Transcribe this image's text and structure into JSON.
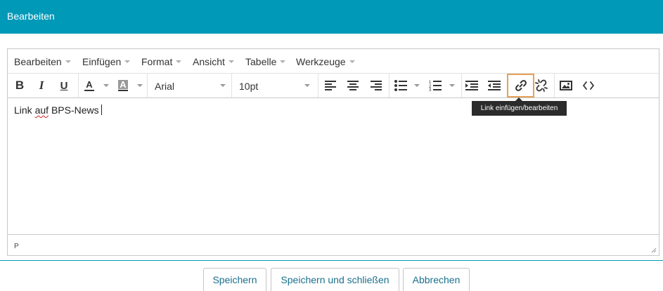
{
  "header": {
    "title": "Bearbeiten"
  },
  "menubar": {
    "items": [
      {
        "label": "Bearbeiten"
      },
      {
        "label": "Einfügen"
      },
      {
        "label": "Format"
      },
      {
        "label": "Ansicht"
      },
      {
        "label": "Tabelle"
      },
      {
        "label": "Werkzeuge"
      }
    ]
  },
  "toolbar": {
    "font_family": "Arial",
    "font_size": "10pt",
    "icons": [
      "bold-icon",
      "italic-icon",
      "underline-icon",
      "text-color-icon",
      "background-color-icon",
      "align-left-icon",
      "align-center-icon",
      "align-right-icon",
      "bullet-list-icon",
      "numbered-list-icon",
      "indent-icon",
      "outdent-icon",
      "link-icon",
      "unlink-icon",
      "image-icon",
      "source-code-icon"
    ],
    "highlight_color": "#e6a15a"
  },
  "tooltip": {
    "text": "Link einfügen/bearbeiten"
  },
  "content": {
    "word1": "Link",
    "misspelled": "auf",
    "rest": "BPS-News"
  },
  "statusbar": {
    "path": "P"
  },
  "buttons": {
    "save": "Speichern",
    "save_close": "Speichern und schließen",
    "cancel": "Abbrechen"
  },
  "colors": {
    "header": "#0199b8",
    "button_text": "#1a6f8c"
  }
}
